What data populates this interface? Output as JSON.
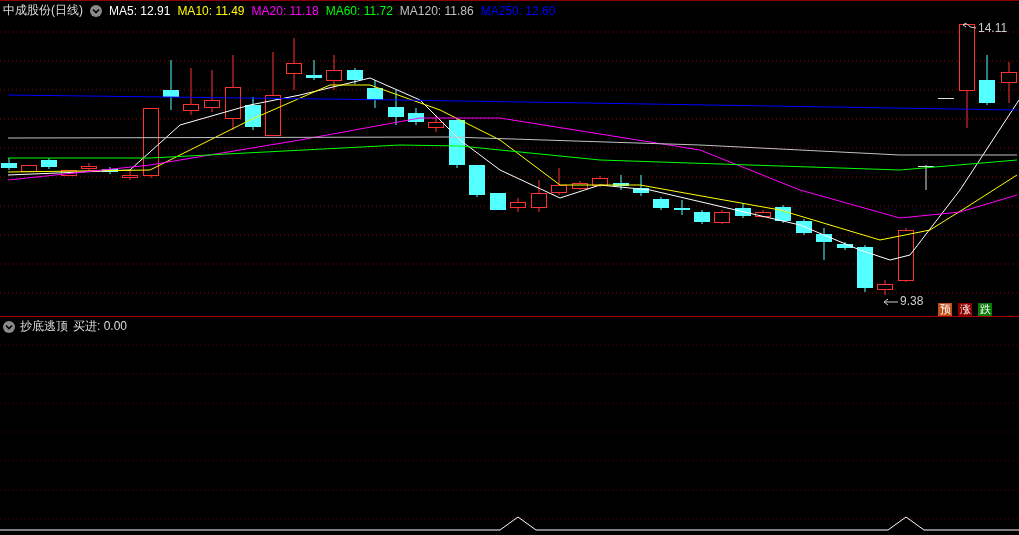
{
  "header": {
    "title": "中成股份(日线)",
    "indicators": [
      {
        "label": "MA5: 12.91",
        "color": "#ffffff"
      },
      {
        "label": "MA10: 11.49",
        "color": "#ffff00"
      },
      {
        "label": "MA20: 11.18",
        "color": "#ff00ff"
      },
      {
        "label": "MA60: 11.72",
        "color": "#00ff00"
      },
      {
        "label": "MA120: 11.86",
        "color": "#c0c0c0"
      },
      {
        "label": "MA250: 12.60",
        "color": "#0000ff"
      }
    ]
  },
  "price_labels": [
    {
      "kind": "high",
      "text": "14.11"
    },
    {
      "kind": "low",
      "text": "9.38"
    }
  ],
  "badges": [
    {
      "text": "预",
      "color": "#c0501a"
    },
    {
      "text": "涨",
      "color": "#8b0000"
    },
    {
      "text": "跌",
      "color": "#0a7a0a"
    }
  ],
  "indicator_panel": {
    "title": "抄底逃顶",
    "reading": "买进: 0.00"
  }
}
